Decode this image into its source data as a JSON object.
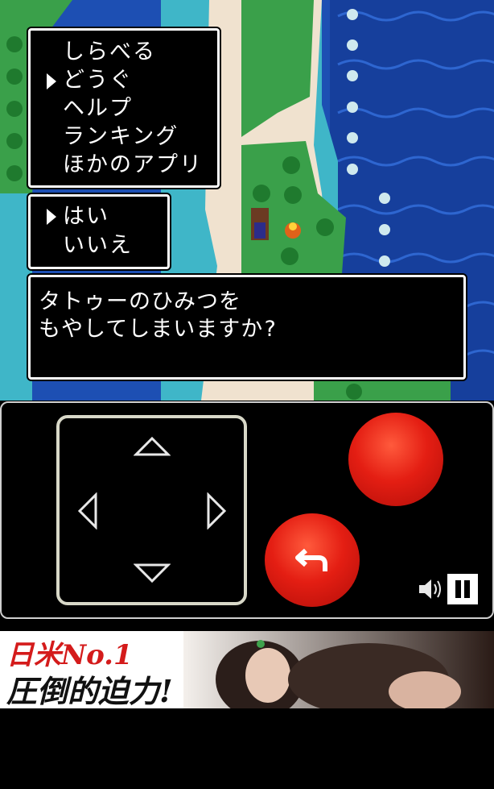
{
  "menu": {
    "items": [
      "しらべる",
      "どうぐ",
      "ヘルプ",
      "ランキング",
      "ほかのアプリ"
    ],
    "selected_index": 1
  },
  "confirm": {
    "yes": "はい",
    "no": "いいえ",
    "selected_index": 0
  },
  "message": {
    "line1": "タトゥーのひみつを",
    "line2": "もやしてしまいますか?"
  },
  "controls": {
    "dpad_icons": [
      "arrow-up-icon",
      "arrow-left-icon",
      "arrow-right-icon",
      "arrow-down-icon"
    ],
    "a_button_color": "#e41e13",
    "b_button_icon": "return-arrow-icon",
    "sound_icon": "speaker-icon",
    "pause_icon": "pause-icon"
  },
  "ad": {
    "line1": "日米No.1",
    "line2": "圧倒的迫力!"
  }
}
